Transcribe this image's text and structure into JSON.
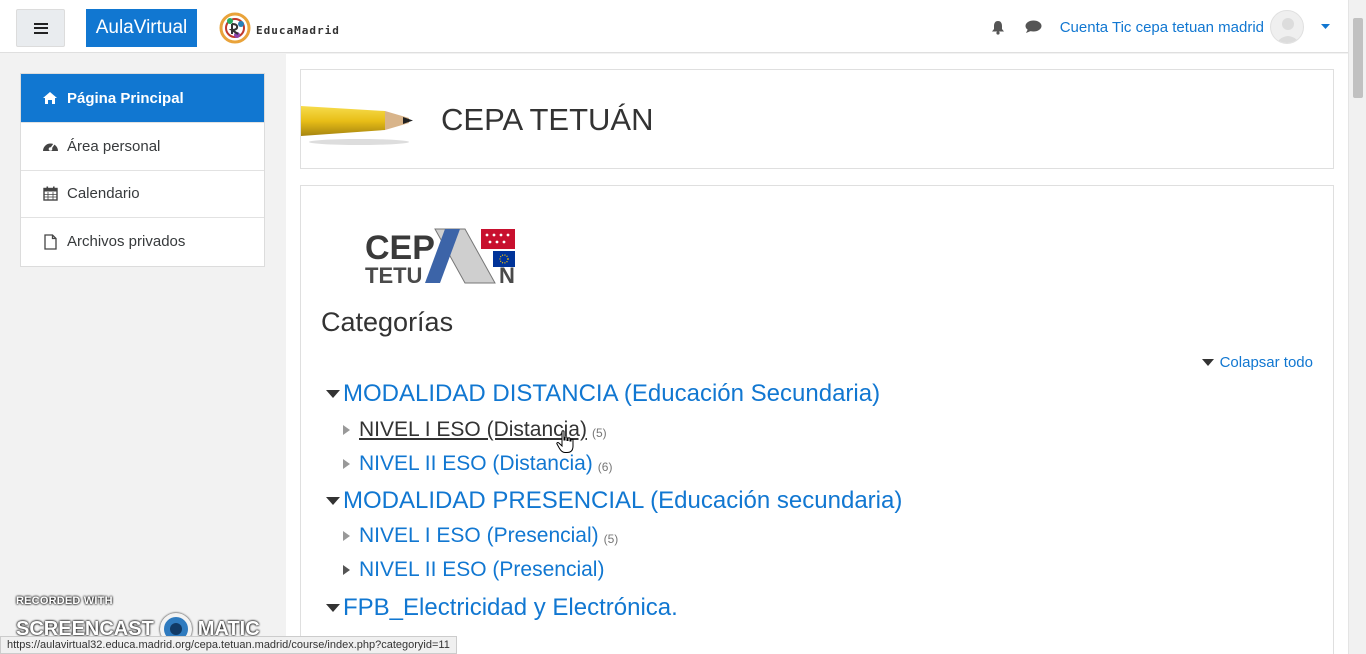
{
  "header": {
    "brand": "AulaVirtual",
    "logo_text": "EducaMadrid",
    "user_name": "Cuenta Tic cepa tetuan madrid",
    "icons": [
      "hamburger-icon",
      "bell-icon",
      "chat-icon",
      "caret-down-icon"
    ]
  },
  "sidebar": {
    "items": [
      {
        "label": "Página Principal",
        "icon": "home-icon",
        "active": true
      },
      {
        "label": "Área personal",
        "icon": "dashboard-icon",
        "active": false
      },
      {
        "label": "Calendario",
        "icon": "calendar-icon",
        "active": false
      },
      {
        "label": "Archivos privados",
        "icon": "file-icon",
        "active": false
      }
    ]
  },
  "main": {
    "site_title": "CEPA TETUÁN",
    "categories_heading": "Categorías",
    "collapse_all": "Colapsar todo",
    "categories": [
      {
        "label": "MODALIDAD DISTANCIA (Educación Secundaria)",
        "subcategories": [
          {
            "label": "NIVEL I ESO (Distancia)",
            "count": "(5)"
          },
          {
            "label": "NIVEL II ESO (Distancia)",
            "count": "(6)"
          }
        ]
      },
      {
        "label": "MODALIDAD PRESENCIAL (Educación secundaria)",
        "subcategories": [
          {
            "label": "NIVEL I ESO (Presencial)",
            "count": "(5)"
          },
          {
            "label": "NIVEL II ESO (Presencial)",
            "count": ""
          }
        ]
      },
      {
        "label": "FPB_Electricidad y Electrónica.",
        "subcategories": []
      }
    ]
  },
  "statusbar": {
    "url": "https://aulavirtual32.educa.madrid.org/cepa.tetuan.madrid/course/index.php?categoryid=11"
  },
  "watermark": {
    "line1": "RECORDED WITH",
    "line2a": "SCREENCAST",
    "line2b": "MATIC"
  },
  "colors": {
    "accent": "#1177d1",
    "sidebar_bg": "#f2f2f2"
  }
}
